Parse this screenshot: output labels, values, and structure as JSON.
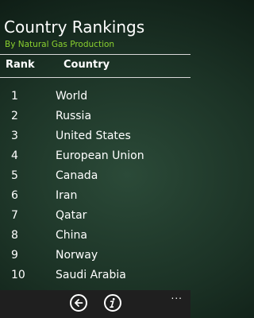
{
  "header": {
    "title": "Country Rankings",
    "subtitle": "By Natural Gas Production"
  },
  "table": {
    "columns": {
      "rank": "Rank",
      "country": "Country"
    },
    "rows": [
      {
        "rank": "1",
        "country": "World"
      },
      {
        "rank": "2",
        "country": "Russia"
      },
      {
        "rank": "3",
        "country": "United States"
      },
      {
        "rank": "4",
        "country": "European Union"
      },
      {
        "rank": "5",
        "country": "Canada"
      },
      {
        "rank": "6",
        "country": "Iran"
      },
      {
        "rank": "7",
        "country": "Qatar"
      },
      {
        "rank": "8",
        "country": "China"
      },
      {
        "rank": "9",
        "country": "Norway"
      },
      {
        "rank": "10",
        "country": "Saudi Arabia"
      }
    ]
  },
  "app_bar": {
    "back_icon": "back-arrow-icon",
    "info_icon": "info-icon",
    "more_label": "..."
  },
  "colors": {
    "accent": "#8ad12f",
    "app_bar": "#1f1f1f"
  }
}
